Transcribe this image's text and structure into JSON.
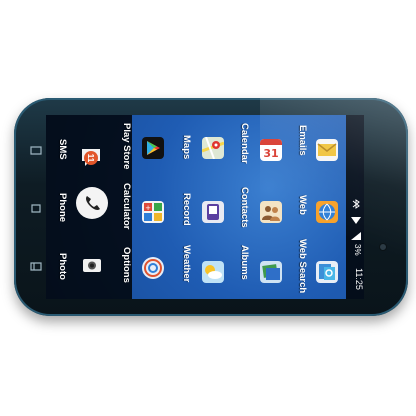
{
  "dock": {
    "items": [
      {
        "label": "SMS",
        "badge": "11"
      },
      {
        "label": "Phone"
      },
      {
        "label": "Photo"
      }
    ]
  },
  "apps": [
    {
      "label": "Play Store"
    },
    {
      "label": "Calculator"
    },
    {
      "label": "Options"
    },
    {
      "label": "Maps"
    },
    {
      "label": "Record"
    },
    {
      "label": "Weather"
    },
    {
      "label": "Calendar"
    },
    {
      "label": "Contacts"
    },
    {
      "label": "Albums"
    },
    {
      "label": "Emails"
    },
    {
      "label": "Web"
    },
    {
      "label": "Web Search"
    }
  ],
  "status": {
    "time": "11:25",
    "battery": "3%"
  }
}
